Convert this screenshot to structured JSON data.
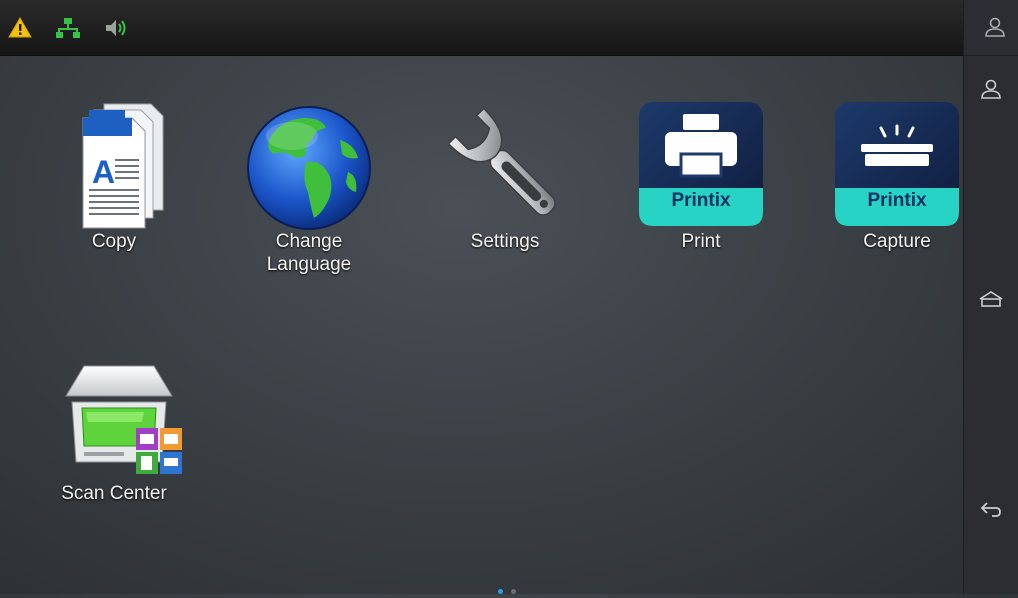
{
  "status_bar": {
    "icons": [
      "warning-icon",
      "network-icon",
      "speaker-icon"
    ],
    "colors": {
      "warning": "#f4c20d",
      "network": "#35c446",
      "speaker": "#35c446"
    }
  },
  "apps": [
    {
      "id": "copy",
      "label": "Copy",
      "icon": "copy-document-icon"
    },
    {
      "id": "change-language",
      "label": "Change\nLanguage",
      "icon": "globe-icon"
    },
    {
      "id": "settings",
      "label": "Settings",
      "icon": "wrench-icon"
    },
    {
      "id": "print",
      "label": "Print",
      "icon": "printix-print-icon",
      "badge": "Printix"
    },
    {
      "id": "capture",
      "label": "Capture",
      "icon": "printix-capture-icon",
      "badge": "Printix"
    },
    {
      "id": "scan-center",
      "label": "Scan Center",
      "icon": "scanner-icon"
    }
  ],
  "side_nav": {
    "icons": [
      "user-icon",
      "user-icon",
      "home-icon",
      "back-icon"
    ]
  },
  "pager": {
    "current_page": 1,
    "total_pages": 2,
    "active_color": "#2a9df4"
  }
}
